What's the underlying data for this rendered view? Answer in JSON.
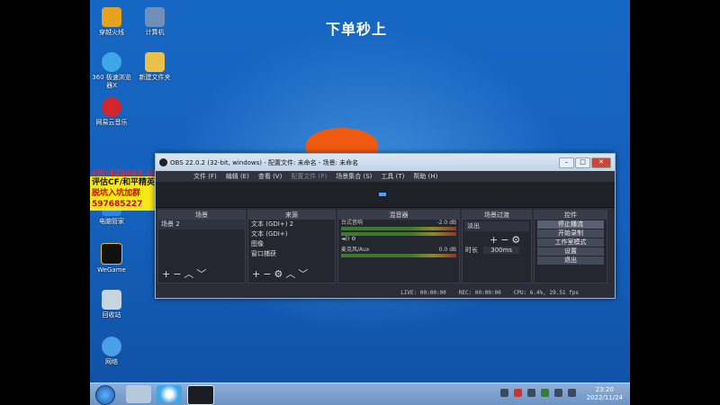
{
  "desktop": {
    "headline": "下单秒上",
    "icons": [
      {
        "label": "穿越火线",
        "color": "#e5a21c"
      },
      {
        "label": "计算机",
        "color": "#6f8fb8"
      },
      {
        "label": "360 极速浏览器X",
        "color": "#3fa7e6"
      },
      {
        "label": "新建文件夹",
        "color": "#e8c04a"
      },
      {
        "label": "网易云音乐",
        "color": "#d3262c"
      },
      {
        "label": "电脑管家",
        "color": "#2a87e8"
      },
      {
        "label": "WeGame",
        "color": "#111111"
      },
      {
        "label": "回收站",
        "color": "#c7d4e2"
      },
      {
        "label": "网络",
        "color": "#4aa0e8"
      }
    ],
    "ad_line1": "v信:422043（承诺）",
    "ad_line2": "评估CF/和平精英/手游",
    "ad_line3": "脱坑入坑加群597685227"
  },
  "obs": {
    "title": "OBS 22.0.2 (32-bit, windows) - 配置文件: 未命名 - 场景: 未命名",
    "menu": [
      "文件 (F)",
      "编辑 (E)",
      "查看 (V)",
      "配置文件 (P)",
      "场景集合 (S)",
      "工具 (T)",
      "帮助 (H)"
    ],
    "docks": {
      "scenes": {
        "title": "场景",
        "items": [
          "场景 2"
        ]
      },
      "sources": {
        "title": "来源",
        "items": [
          "文本 (GDI+) 2",
          "文本 (GDI+)",
          "图像",
          "窗口捕获"
        ]
      },
      "mixer": {
        "title": "混音器",
        "channels": [
          {
            "name": "台式音响",
            "db": "-2.0 dB",
            "level": 0.6
          },
          {
            "name": "麦克风/Aux",
            "db": "0.0 dB",
            "level": 0.5
          }
        ]
      },
      "transitions": {
        "title": "场景过渡",
        "type": "淡出",
        "duration_label": "时长",
        "duration": "300ms"
      },
      "controls": {
        "title": "控件",
        "buttons": [
          "停止播流",
          "开始录制",
          "工作室模式",
          "设置",
          "退出"
        ]
      }
    },
    "status": {
      "live": "LIVE: 00:00:00",
      "rec": "REC: 00:00:00",
      "cpu": "CPU: 6.4%, 29.51 fps"
    }
  },
  "taskbar": {
    "time": "23:20",
    "date": "2022/11/24"
  }
}
